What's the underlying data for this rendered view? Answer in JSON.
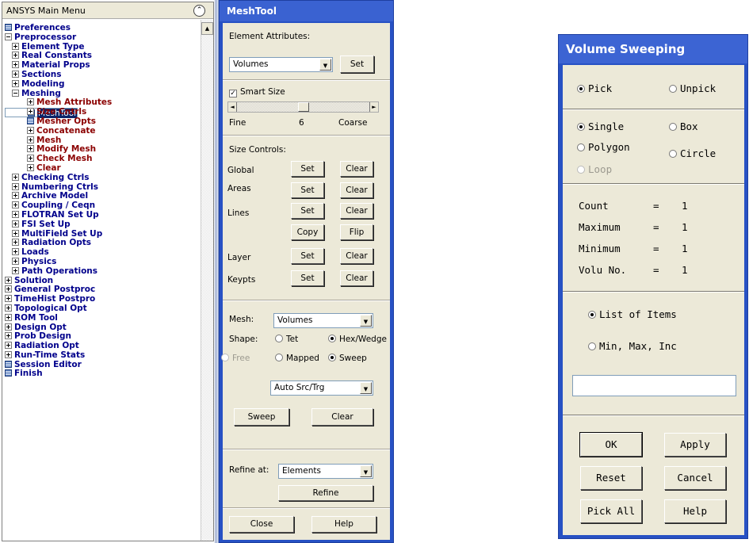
{
  "main_menu": {
    "title": "ANSYS Main Menu",
    "collapse_icon": "double-chevron-up-icon",
    "items": [
      {
        "label": "Preferences",
        "icon": "doc",
        "level": 0,
        "color": "blue"
      },
      {
        "label": "Preprocessor",
        "icon": "minus",
        "level": 0,
        "color": "blue"
      },
      {
        "label": "Element Type",
        "icon": "plus",
        "level": 1,
        "color": "blue"
      },
      {
        "label": "Real Constants",
        "icon": "plus",
        "level": 1,
        "color": "blue"
      },
      {
        "label": "Material Props",
        "icon": "plus",
        "level": 1,
        "color": "blue"
      },
      {
        "label": "Sections",
        "icon": "plus",
        "level": 1,
        "color": "blue"
      },
      {
        "label": "Modeling",
        "icon": "plus",
        "level": 1,
        "color": "blue"
      },
      {
        "label": "Meshing",
        "icon": "minus",
        "level": 1,
        "color": "blue"
      },
      {
        "label": "Mesh Attributes",
        "icon": "plus",
        "level": 2,
        "color": "red"
      },
      {
        "label": "MeshTool",
        "icon": "doc",
        "level": 2,
        "color": "red",
        "selected": true
      },
      {
        "label": "Size Cntrls",
        "icon": "plus",
        "level": 2,
        "color": "red"
      },
      {
        "label": "Mesher Opts",
        "icon": "doc",
        "level": 2,
        "color": "red"
      },
      {
        "label": "Concatenate",
        "icon": "plus",
        "level": 2,
        "color": "red"
      },
      {
        "label": "Mesh",
        "icon": "plus",
        "level": 2,
        "color": "red"
      },
      {
        "label": "Modify Mesh",
        "icon": "plus",
        "level": 2,
        "color": "red"
      },
      {
        "label": "Check Mesh",
        "icon": "plus",
        "level": 2,
        "color": "red"
      },
      {
        "label": "Clear",
        "icon": "plus",
        "level": 2,
        "color": "red"
      },
      {
        "label": "Checking Ctrls",
        "icon": "plus",
        "level": 1,
        "color": "blue"
      },
      {
        "label": "Numbering Ctrls",
        "icon": "plus",
        "level": 1,
        "color": "blue"
      },
      {
        "label": "Archive Model",
        "icon": "plus",
        "level": 1,
        "color": "blue"
      },
      {
        "label": "Coupling / Ceqn",
        "icon": "plus",
        "level": 1,
        "color": "blue"
      },
      {
        "label": "FLOTRAN Set Up",
        "icon": "plus",
        "level": 1,
        "color": "blue"
      },
      {
        "label": "FSI Set Up",
        "icon": "plus",
        "level": 1,
        "color": "blue"
      },
      {
        "label": "MultiField Set Up",
        "icon": "plus",
        "level": 1,
        "color": "blue"
      },
      {
        "label": "Radiation Opts",
        "icon": "plus",
        "level": 1,
        "color": "blue"
      },
      {
        "label": "Loads",
        "icon": "plus",
        "level": 1,
        "color": "blue"
      },
      {
        "label": "Physics",
        "icon": "plus",
        "level": 1,
        "color": "blue"
      },
      {
        "label": "Path Operations",
        "icon": "plus",
        "level": 1,
        "color": "blue"
      },
      {
        "label": "Solution",
        "icon": "plus",
        "level": 0,
        "color": "blue"
      },
      {
        "label": "General Postproc",
        "icon": "plus",
        "level": 0,
        "color": "blue"
      },
      {
        "label": "TimeHist Postpro",
        "icon": "plus",
        "level": 0,
        "color": "blue"
      },
      {
        "label": "Topological Opt",
        "icon": "plus",
        "level": 0,
        "color": "blue"
      },
      {
        "label": "ROM Tool",
        "icon": "plus",
        "level": 0,
        "color": "blue"
      },
      {
        "label": "Design Opt",
        "icon": "plus",
        "level": 0,
        "color": "blue"
      },
      {
        "label": "Prob Design",
        "icon": "plus",
        "level": 0,
        "color": "blue"
      },
      {
        "label": "Radiation Opt",
        "icon": "plus",
        "level": 0,
        "color": "blue"
      },
      {
        "label": "Run-Time Stats",
        "icon": "plus",
        "level": 0,
        "color": "blue"
      },
      {
        "label": "Session Editor",
        "icon": "doc",
        "level": 0,
        "color": "blue"
      },
      {
        "label": "Finish",
        "icon": "doc",
        "level": 0,
        "color": "blue"
      }
    ]
  },
  "meshtool": {
    "title": "MeshTool",
    "element_attributes_label": "Element Attributes:",
    "element_attributes_value": "Volumes",
    "set_label": "Set",
    "smart_size_label": "Smart Size",
    "smart_size_checked": true,
    "slider_value": 6,
    "slider_fraction": 0.5,
    "fine_label": "Fine",
    "slider_value_text": "6",
    "coarse_label": "Coarse",
    "size_controls_label": "Size Controls:",
    "rows": {
      "global": "Global",
      "areas": "Areas",
      "lines": "Lines",
      "layer": "Layer",
      "keypts": "Keypts"
    },
    "clear_label": "Clear",
    "copy_label": "Copy",
    "flip_label": "Flip",
    "mesh_label": "Mesh:",
    "mesh_value": "Volumes",
    "shape_label": "Shape:",
    "tet_label": "Tet",
    "hexwedge_label": "Hex/Wedge",
    "free_label": "Free",
    "mapped_label": "Mapped",
    "sweep_label": "Sweep",
    "auto_src_value": "Auto Src/Trg",
    "sweep_button": "Sweep",
    "clear_button": "Clear",
    "refine_at_label": "Refine at:",
    "refine_at_value": "Elements",
    "refine_button": "Refine",
    "close_button": "Close",
    "help_button": "Help"
  },
  "volume_sweeping": {
    "title": "Volume Sweeping",
    "pick_label": "Pick",
    "unpick_label": "Unpick",
    "single_label": "Single",
    "box_label": "Box",
    "polygon_label": "Polygon",
    "circle_label": "Circle",
    "loop_label": "Loop",
    "count_label": "Count",
    "maximum_label": "Maximum",
    "minimum_label": "Minimum",
    "volu_no_label": "Volu No.",
    "equals": "=",
    "count_value": "1",
    "maximum_value": "1",
    "minimum_value": "1",
    "volu_no_value": "1",
    "list_items_label": "List of Items",
    "min_max_inc_label": "Min, Max, Inc",
    "input_value": "",
    "ok": "OK",
    "apply": "Apply",
    "reset": "Reset",
    "cancel": "Cancel",
    "pick_all": "Pick All",
    "help": "Help"
  }
}
